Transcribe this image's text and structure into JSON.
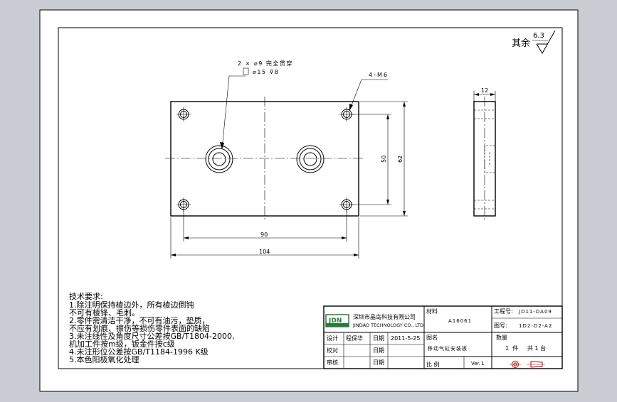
{
  "surface_finish": {
    "label": "其余",
    "value": "6.3"
  },
  "callouts": {
    "hole_line1": "2 × ⌀9 完全贯穿",
    "hole_line2": "⌀15 ⊽8",
    "tap_holes": "4-M6"
  },
  "dimensions": {
    "height_inner": "50",
    "height_outer": "62",
    "width_inner": "90",
    "width_outer": "104",
    "thickness": "12"
  },
  "tech_requirements": {
    "title": "技术要求:",
    "items": [
      "1.除注明保持棱边外，所有棱边倒钝",
      "  不可有棱锋、毛刺。",
      "2.零件需清洁干净，不可有油污，垫质，",
      "  不应有划痕、擦伤等损伤零件表面的缺陷",
      "3.未注线性及角度尺寸公差按GB/T1804-2000,",
      "  机加工件按m级，钣金件按c级",
      "4.未注形位公差按GB/T1184-1996 K级",
      "5.本色阳极氧化处理"
    ]
  },
  "title_block": {
    "logo_text": "JDN",
    "company_cn": "深圳市晶岛科技有限公司",
    "company_en": "JINDAO TECHNOLOGY CO., LTD",
    "material_label": "材料",
    "material_value": "A16061",
    "project_no_label": "工程号:",
    "project_no_value": "JD11-DA09",
    "drawing_no_label": "图号:",
    "drawing_no_value": "1D2-D2-A2",
    "drawing_name_label": "图名",
    "drawing_name_value": "移动气缸安装板",
    "qty_label": "数量",
    "qty_value": "1  件     共 1 台",
    "designer_label": "设计",
    "designer_value": "程保华",
    "checker_label": "校对",
    "approver_label": "审核",
    "date_label": "日期",
    "date_value": "2011-5-25",
    "scale_label": "比 例",
    "version_label": "Ver.",
    "version_value": "1"
  }
}
